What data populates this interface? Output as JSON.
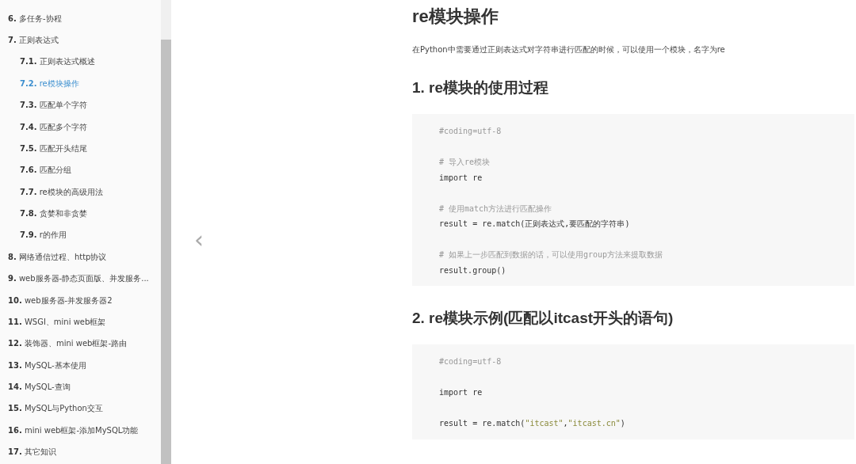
{
  "sidebar": {
    "items": [
      {
        "number": "6.",
        "title": "多任务-协程",
        "selected": false
      },
      {
        "number": "7.",
        "title": "正则表达式",
        "selected": false,
        "children": [
          {
            "number": "7.1.",
            "title": "正则表达式概述",
            "selected": false
          },
          {
            "number": "7.2.",
            "title": "re模块操作",
            "selected": true
          },
          {
            "number": "7.3.",
            "title": "匹配单个字符",
            "selected": false
          },
          {
            "number": "7.4.",
            "title": "匹配多个字符",
            "selected": false
          },
          {
            "number": "7.5.",
            "title": "匹配开头结尾",
            "selected": false
          },
          {
            "number": "7.6.",
            "title": "匹配分组",
            "selected": false
          },
          {
            "number": "7.7.",
            "title": "re模块的高级用法",
            "selected": false
          },
          {
            "number": "7.8.",
            "title": "贪婪和非贪婪",
            "selected": false
          },
          {
            "number": "7.9.",
            "title": "r的作用",
            "selected": false
          }
        ]
      },
      {
        "number": "8.",
        "title": "网络通信过程、http协议",
        "selected": false
      },
      {
        "number": "9.",
        "title": "web服务器-静态页面版、并发服务...",
        "selected": false
      },
      {
        "number": "10.",
        "title": "web服务器-并发服务器2",
        "selected": false
      },
      {
        "number": "11.",
        "title": "WSGI、mini web框架",
        "selected": false
      },
      {
        "number": "12.",
        "title": "装饰器、mini web框架-路由",
        "selected": false
      },
      {
        "number": "13.",
        "title": "MySQL-基本使用",
        "selected": false
      },
      {
        "number": "14.",
        "title": "MySQL-查询",
        "selected": false
      },
      {
        "number": "15.",
        "title": "MySQL与Python交互",
        "selected": false
      },
      {
        "number": "16.",
        "title": "mini web框架-添加MySQL功能",
        "selected": false
      },
      {
        "number": "17.",
        "title": "其它知识",
        "selected": false
      }
    ]
  },
  "prev_button": {
    "symbol": "‹"
  },
  "article": {
    "title": "re模块操作",
    "blocks": [
      {
        "kind": "paragraph",
        "text": "在Python中需要通过正则表达式对字符串进行匹配的时候，可以使用一个模块，名字为re"
      },
      {
        "kind": "heading",
        "text": "1. re模块的使用过程"
      },
      {
        "kind": "code",
        "groups": [
          [
            [
              {
                "kind": "comment",
                "text": "#coding=utf-8"
              }
            ]
          ],
          [
            [
              {
                "kind": "comment",
                "text": "# 导入re模块"
              }
            ],
            [
              {
                "kind": "plain",
                "text": "import re"
              }
            ]
          ],
          [
            [
              {
                "kind": "comment",
                "text": "# 使用match方法进行匹配操作"
              }
            ],
            [
              {
                "kind": "plain",
                "text": "result = re.match(正则表达式,要匹配的字符串)"
              }
            ]
          ],
          [
            [
              {
                "kind": "comment",
                "text": "# 如果上一步匹配到数据的话，可以使用group方法来提取数据"
              }
            ],
            [
              {
                "kind": "plain",
                "text": "result.group()"
              }
            ]
          ]
        ]
      },
      {
        "kind": "heading",
        "text": "2. re模块示例(匹配以itcast开头的语句)"
      },
      {
        "kind": "code",
        "groups": [
          [
            [
              {
                "kind": "comment",
                "text": "#coding=utf-8"
              }
            ]
          ],
          [
            [
              {
                "kind": "plain",
                "text": "import re"
              }
            ]
          ],
          [
            [
              {
                "kind": "plain",
                "text": "result = re.match("
              },
              {
                "kind": "string",
                "text": "\"itcast\""
              },
              {
                "kind": "plain",
                "text": ","
              },
              {
                "kind": "string",
                "text": "\"itcast.cn\""
              },
              {
                "kind": "plain",
                "text": ")"
              }
            ]
          ]
        ]
      }
    ]
  }
}
